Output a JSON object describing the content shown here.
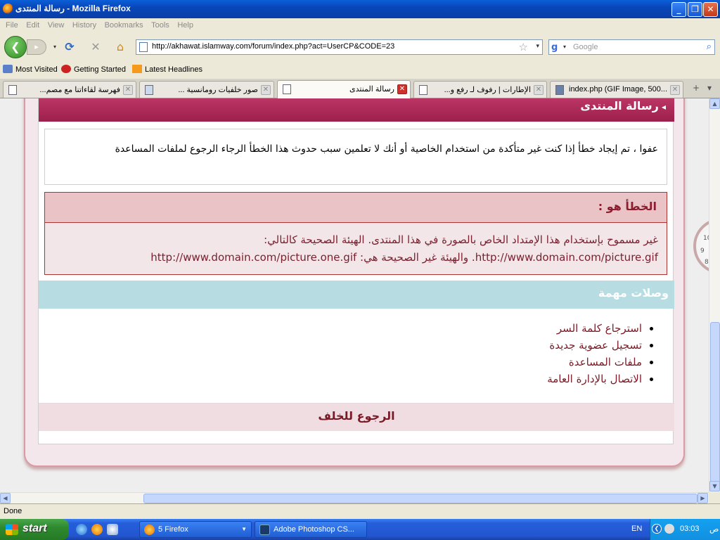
{
  "window": {
    "title": "رسالة المنتدى - Mozilla Firefox"
  },
  "menu": [
    "File",
    "Edit",
    "View",
    "History",
    "Bookmarks",
    "Tools",
    "Help"
  ],
  "nav": {
    "url": "http://akhawat.islamway.com/forum/index.php?act=UserCP&CODE=23",
    "search_placeholder": "Google"
  },
  "bookmarks": [
    "Most Visited",
    "Getting Started",
    "Latest Headlines"
  ],
  "tabs": [
    {
      "label": "فهرسة لقاءاتنا مع مصم..."
    },
    {
      "label": "صور خلفيات رومانسية ..."
    },
    {
      "label": "رسالة المنتدى"
    },
    {
      "label": "الإطارات | رفوف لـ رفع و..."
    },
    {
      "label": "index.php (GIF Image, 500..."
    }
  ],
  "page": {
    "header": "رسالة المنتدى",
    "message": "عفوا ، تم إيجاد خطأ إذا كنت غير متأكدة من استخدام الخاصية أو أنك لا تعلمين سبب حدوث هذا الخطأ الرجاء الرجوع لملفات المساعدة",
    "error_title": "الخطأ هو :",
    "error_line1": "غير مسموح بإستخدام هذا الإمتداد الخاص بالصورة في هذا المنتدى. الهيئة الصحيحة كالتالي:",
    "error_line2": "http://www.domain.com/picture.gif. والهيئة غير الصحيحة هي: http://www.domain.com/picture.one.gif",
    "links_title": "وصلات مهمة",
    "links": [
      "استرجاع كلمة السر",
      "تسجيل عضوية جديدة",
      "ملفات المساعدة",
      "الاتصال بالإدارة العامة"
    ],
    "back": "الرجوع للخلف"
  },
  "status": "Done",
  "taskbar": {
    "start": "start",
    "tasks": [
      {
        "label": "5 Firefox"
      },
      {
        "label": "Adobe Photoshop CS..."
      }
    ],
    "lang": "EN",
    "time": "03:03",
    "ampm": "ص"
  }
}
